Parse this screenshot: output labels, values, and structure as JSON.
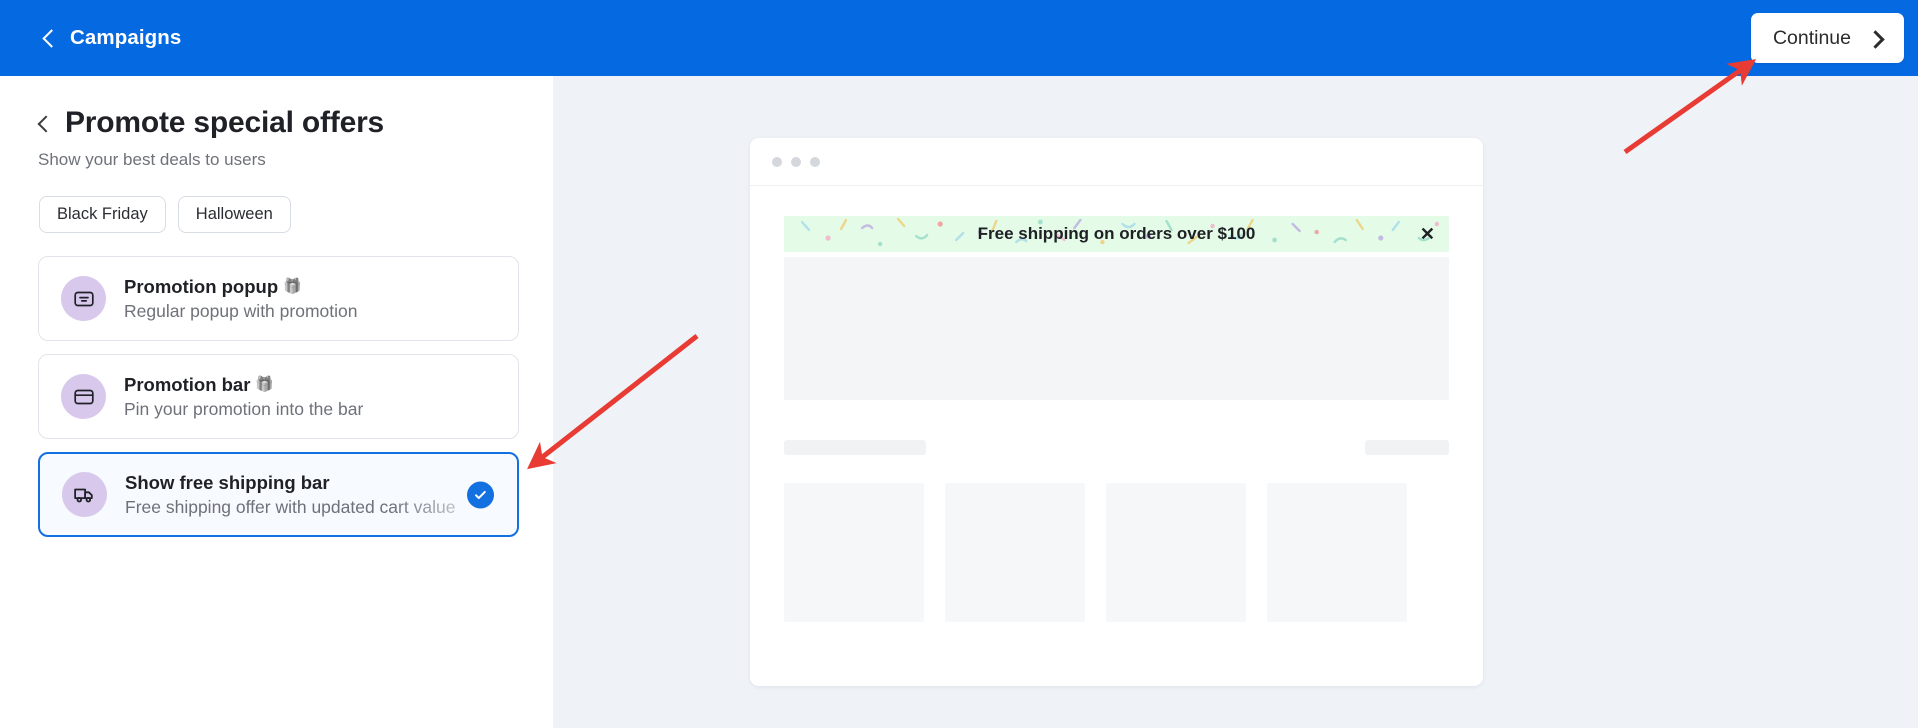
{
  "topbar": {
    "back_label": "Campaigns",
    "back_icon": "chevron-left-icon",
    "continue_label": "Continue",
    "continue_icon": "chevron-right-icon",
    "background_color": "#056ae2"
  },
  "page": {
    "back_icon": "chevron-left-icon",
    "title": "Promote special offers",
    "subtitle": "Show your best deals to users"
  },
  "chips": [
    {
      "label": "Black Friday"
    },
    {
      "label": "Halloween"
    }
  ],
  "options": [
    {
      "icon": "popup-icon",
      "title": "Promotion popup",
      "badge_icon": "gift-icon",
      "badge": "🎁",
      "description": "Regular popup with promotion",
      "selected": false
    },
    {
      "icon": "bar-window-icon",
      "title": "Promotion bar",
      "badge_icon": "gift-icon",
      "badge": "🎁",
      "description": "Pin your promotion into the bar",
      "selected": false
    },
    {
      "icon": "truck-icon",
      "title": "Show free shipping bar",
      "badge_icon": "",
      "badge": "",
      "description": "Free shipping offer with updated cart value",
      "selected": true
    }
  ],
  "selection": {
    "selected_index": 2,
    "check_icon": "check-circle-icon",
    "accent_color": "#1270e0"
  },
  "preview": {
    "window_dots": 3,
    "banner": {
      "text": "Free shipping on orders over $100",
      "close_icon": "close-icon",
      "close_label": "✕",
      "background_color": "#e4fbe8"
    },
    "product_card_count": 4
  },
  "annotations": [
    {
      "name": "arrow-to-selected-option",
      "color": "#e83b34"
    },
    {
      "name": "arrow-to-continue-button",
      "color": "#e83b34"
    }
  ]
}
